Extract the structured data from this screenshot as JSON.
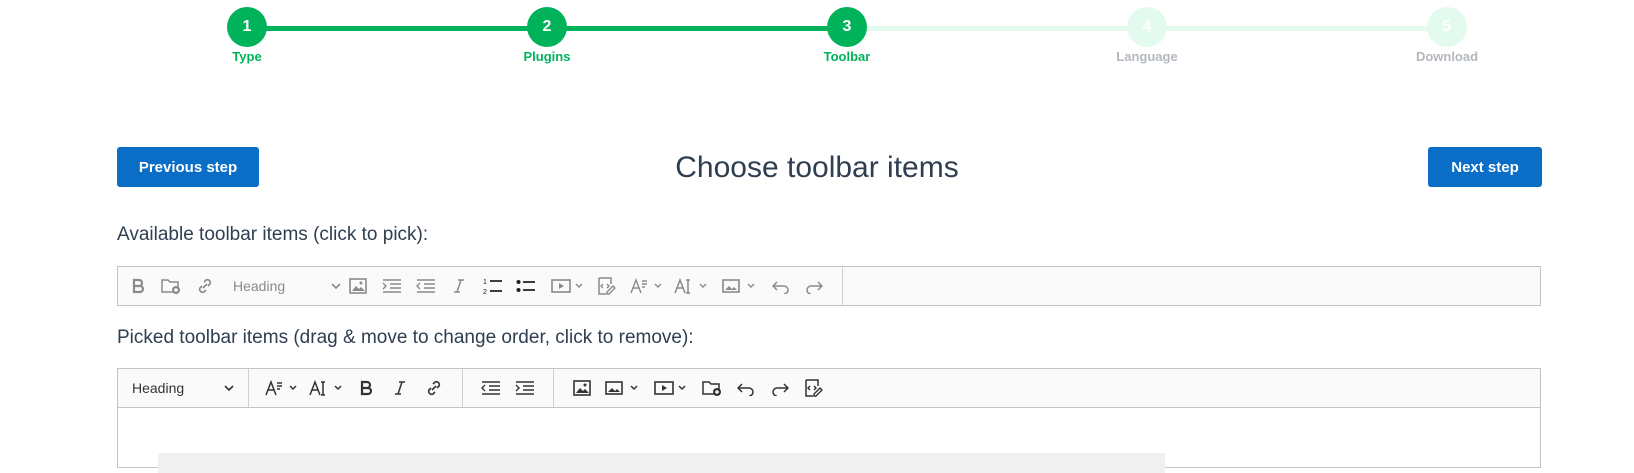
{
  "stepper": {
    "steps": [
      {
        "number": "1",
        "label": "Type",
        "state": "done"
      },
      {
        "number": "2",
        "label": "Plugins",
        "state": "done"
      },
      {
        "number": "3",
        "label": "Toolbar",
        "state": "current"
      },
      {
        "number": "4",
        "label": "Language",
        "state": "todo"
      },
      {
        "number": "5",
        "label": "Download",
        "state": "todo"
      }
    ],
    "colors": {
      "done": "#00b35a",
      "todo": "#e3faee",
      "todo_label": "#b3b8bf"
    }
  },
  "header": {
    "previous_label": "Previous step",
    "title": "Choose toolbar items",
    "next_label": "Next step",
    "button_color": "#0a6ec7"
  },
  "available": {
    "label": "Available toolbar items (click to pick):",
    "heading_value": "Heading",
    "items": [
      "bold-icon",
      "upload-file-icon",
      "link-icon",
      "heading-dropdown",
      "image-icon",
      "indent-icon",
      "outdent-icon",
      "italic-icon",
      "numbered-list-icon",
      "bulleted-list-icon",
      "media-embed-dropdown",
      "source-edit-icon",
      "font-size-dropdown",
      "font-family-dropdown",
      "image-insert-dropdown",
      "undo-icon",
      "redo-icon"
    ]
  },
  "picked": {
    "label": "Picked toolbar items (drag & move to change order, click to remove):",
    "heading_value": "Heading",
    "items": [
      "heading-dropdown",
      "font-size-dropdown",
      "font-family-dropdown",
      "bold-icon",
      "italic-icon",
      "link-icon",
      "outdent-icon",
      "indent-icon",
      "image-icon",
      "image-insert-dropdown",
      "media-embed-dropdown",
      "upload-file-icon",
      "undo-icon",
      "redo-icon",
      "source-edit-icon"
    ]
  }
}
